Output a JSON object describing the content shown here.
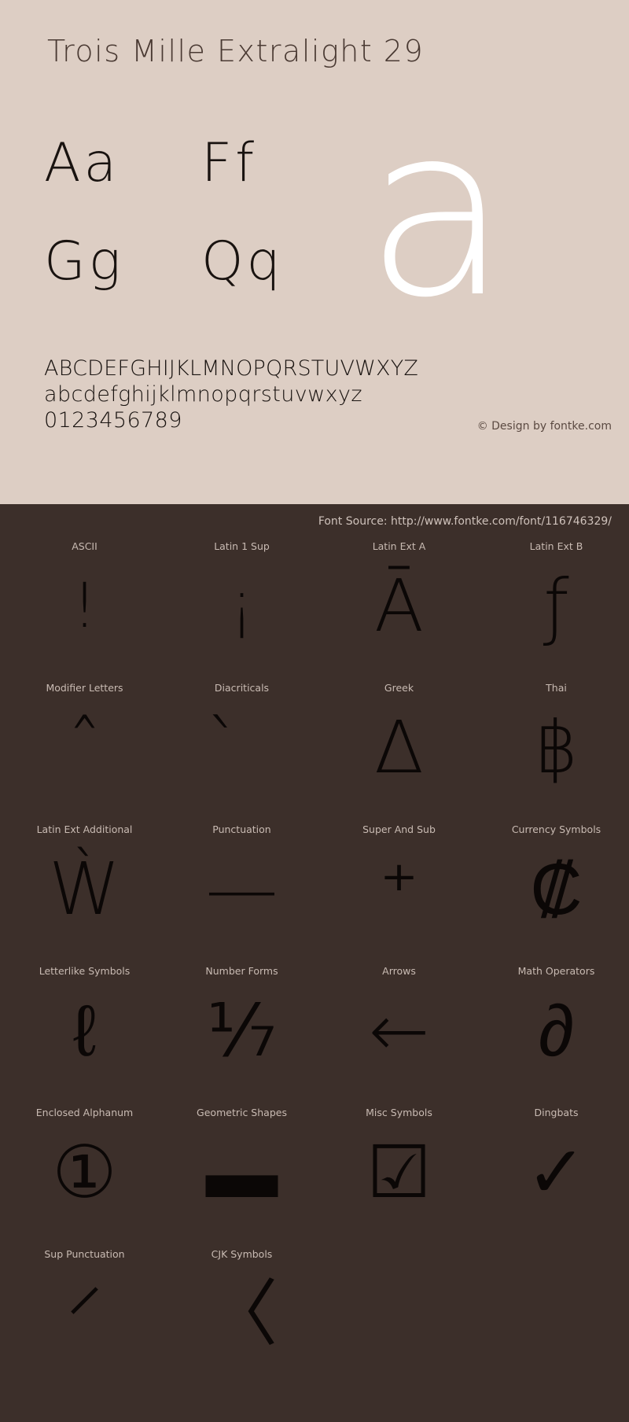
{
  "specimen": {
    "title": "Trois Mille Extralight 29",
    "watermark_glyph": "a",
    "letter_pairs": [
      [
        "Aa",
        "Ff"
      ],
      [
        "Gg",
        "Qq"
      ]
    ],
    "uppercase": "ABCDEFGHIJKLMNOPQRSTUVWXYZ",
    "lowercase": "abcdefghijklmnopqrstuvwxyz",
    "numerals": "0123456789",
    "credit": "© Design by fontke.com",
    "font_source": "Font Source: http://www.fontke.com/font/116746329/"
  },
  "colors": {
    "top_background": "#ddcec4",
    "bottom_background": "#3c2f2a",
    "title_text": "#4a3a33",
    "glyph_ink": "#0b0706",
    "label_text": "#c9bbb3",
    "watermark": "#ffffff"
  },
  "unicode_blocks": {
    "rows": [
      [
        {
          "label": "ASCII",
          "glyph": "!",
          "size": "small"
        },
        {
          "label": "Latin 1 Sup",
          "glyph": "¡",
          "size": "small"
        },
        {
          "label": "Latin Ext A",
          "glyph": "Ā",
          "size": "wide"
        },
        {
          "label": "Latin Ext B",
          "glyph": "ƒ",
          "size": "wide"
        }
      ],
      [
        {
          "label": "Modifier Letters",
          "glyph": "ˆ",
          "size": "wide"
        },
        {
          "label": "Diacriticals",
          "glyph": "̀",
          "size": "wide"
        },
        {
          "label": "Greek",
          "glyph": "Δ",
          "size": "wide"
        },
        {
          "label": "Thai",
          "glyph": "฿",
          "size": "wide"
        }
      ],
      [
        {
          "label": "Latin Ext Additional",
          "glyph": "Ẁ",
          "size": "wide"
        },
        {
          "label": "Punctuation",
          "glyph": "—",
          "size": "wide"
        },
        {
          "label": "Super And Sub",
          "glyph": "⁺",
          "size": "wide"
        },
        {
          "label": "Currency Symbols",
          "glyph": "₡",
          "size": "wide"
        }
      ],
      [
        {
          "label": "Letterlike Symbols",
          "glyph": "ℓ",
          "size": "wide"
        },
        {
          "label": "Number Forms",
          "glyph": "⅐",
          "size": "wide"
        },
        {
          "label": "Arrows",
          "glyph": "←",
          "size": "wide"
        },
        {
          "label": "Math Operators",
          "glyph": "∂",
          "size": "wide"
        }
      ],
      [
        {
          "label": "Enclosed Alphanum",
          "glyph": "①",
          "size": "wide"
        },
        {
          "label": "Geometric Shapes",
          "glyph": "▬",
          "size": "wide"
        },
        {
          "label": "Misc Symbols",
          "glyph": "☑",
          "size": "wide"
        },
        {
          "label": "Dingbats",
          "glyph": "✓",
          "size": "wide"
        }
      ],
      [
        {
          "label": "Sup Punctuation",
          "glyph": "⸍",
          "size": "wide"
        },
        {
          "label": "CJK Symbols",
          "glyph": "〈",
          "size": "wide"
        },
        {
          "label": "",
          "glyph": "",
          "size": "wide",
          "empty": true
        },
        {
          "label": "",
          "glyph": "",
          "size": "wide",
          "empty": true
        }
      ]
    ]
  }
}
